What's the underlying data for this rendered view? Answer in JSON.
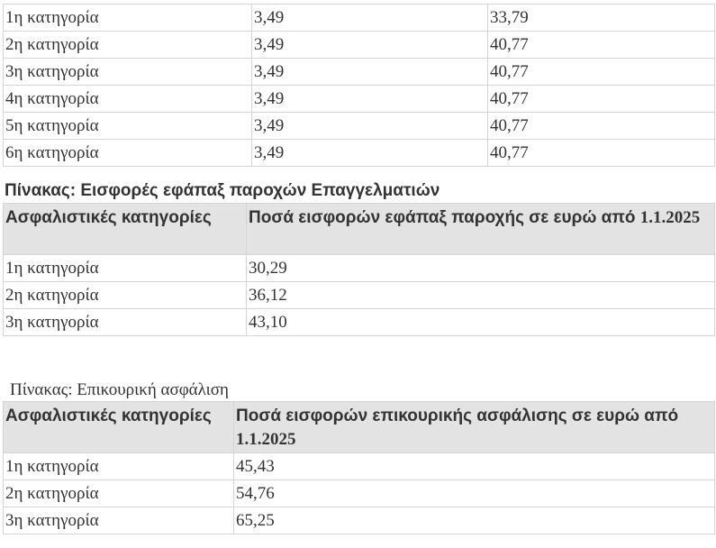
{
  "table_rates": {
    "rows": [
      [
        "1η κατηγορία",
        "3,49",
        "33,79"
      ],
      [
        "2η κατηγορία",
        "3,49",
        "40,77"
      ],
      [
        "3η κατηγορία",
        "3,49",
        "40,77"
      ],
      [
        "4η κατηγορία",
        "3,49",
        "40,77"
      ],
      [
        "5η κατηγορία",
        "3,49",
        "40,77"
      ],
      [
        "6η κατηγορία",
        "3,49",
        "40,77"
      ]
    ]
  },
  "table_lump_sum": {
    "caption": "Πίνακας: Εισφορές εφάπαξ παροχών Επαγγελματιών",
    "header_col1": "Ασφαλιστικές κατηγορίες",
    "header_col2_text": "Ποσά εισφορών εφάπαξ παροχής σε ευρώ από ",
    "header_col2_date": "1.1.2025",
    "rows": [
      [
        "1η κατηγορία",
        "30,29"
      ],
      [
        "2η κατηγορία",
        "36,12"
      ],
      [
        "3η κατηγορία",
        "43,10"
      ]
    ]
  },
  "table_auxiliary": {
    "caption": "Πίνακας: Επικουρική ασφάλιση",
    "header_col1": "Ασφαλιστικές κατηγορίες",
    "header_col2_text": "Ποσά εισφορών επικουρικής ασφάλισης σε ευρώ από ",
    "header_col2_date": "1.1.2025",
    "rows": [
      [
        "1η κατηγορία",
        "45,43"
      ],
      [
        "2η κατηγορία",
        "54,76"
      ],
      [
        "3η κατηγορία",
        "65,25"
      ]
    ]
  }
}
